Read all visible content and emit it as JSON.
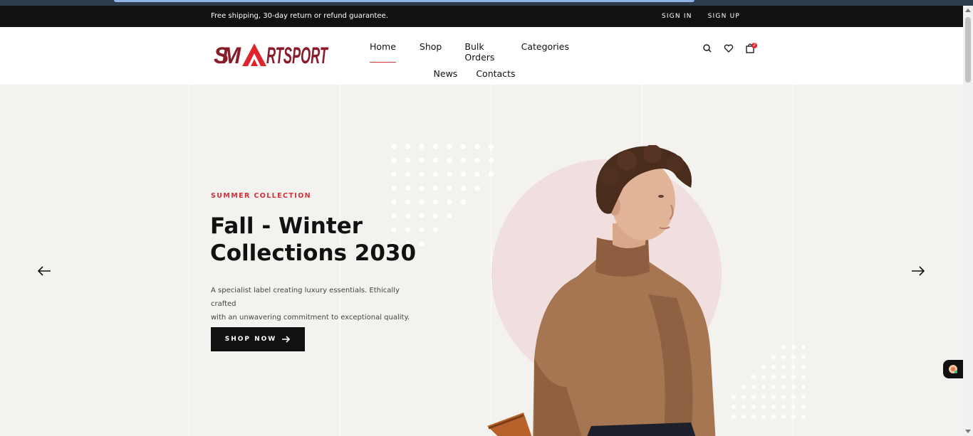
{
  "topbar": {
    "shipping_text": "Free shipping, 30-day return or refund guarantee.",
    "sign_in": "SIGN IN",
    "sign_up": "SIGN UP"
  },
  "header": {
    "logo_text": "SMARTSPORT",
    "nav_row1": [
      "Home",
      "Shop",
      "Bulk Orders",
      "Categories"
    ],
    "nav_row2": [
      "News",
      "Contacts"
    ],
    "active_nav": "Home",
    "cart_count": "2",
    "icons": [
      "search-icon",
      "heart-icon",
      "shopping-bag-icon"
    ]
  },
  "hero": {
    "eyebrow": "SUMMER COLLECTION",
    "headline_line1": "Fall - Winter",
    "headline_line2": "Collections 2030",
    "description_line1": "A specialist label creating luxury essentials. Ethically crafted",
    "description_line2": "with an unwavering commitment to exceptional quality.",
    "cta_label": "SHOP NOW",
    "icons": [
      "arrow-left-icon",
      "arrow-right-icon"
    ]
  },
  "colors": {
    "accent": "#d4303a",
    "dark": "#111111",
    "hero_bg": "#f3f2ee",
    "circle": "#f1dede",
    "logo": "#8a1b2a"
  }
}
